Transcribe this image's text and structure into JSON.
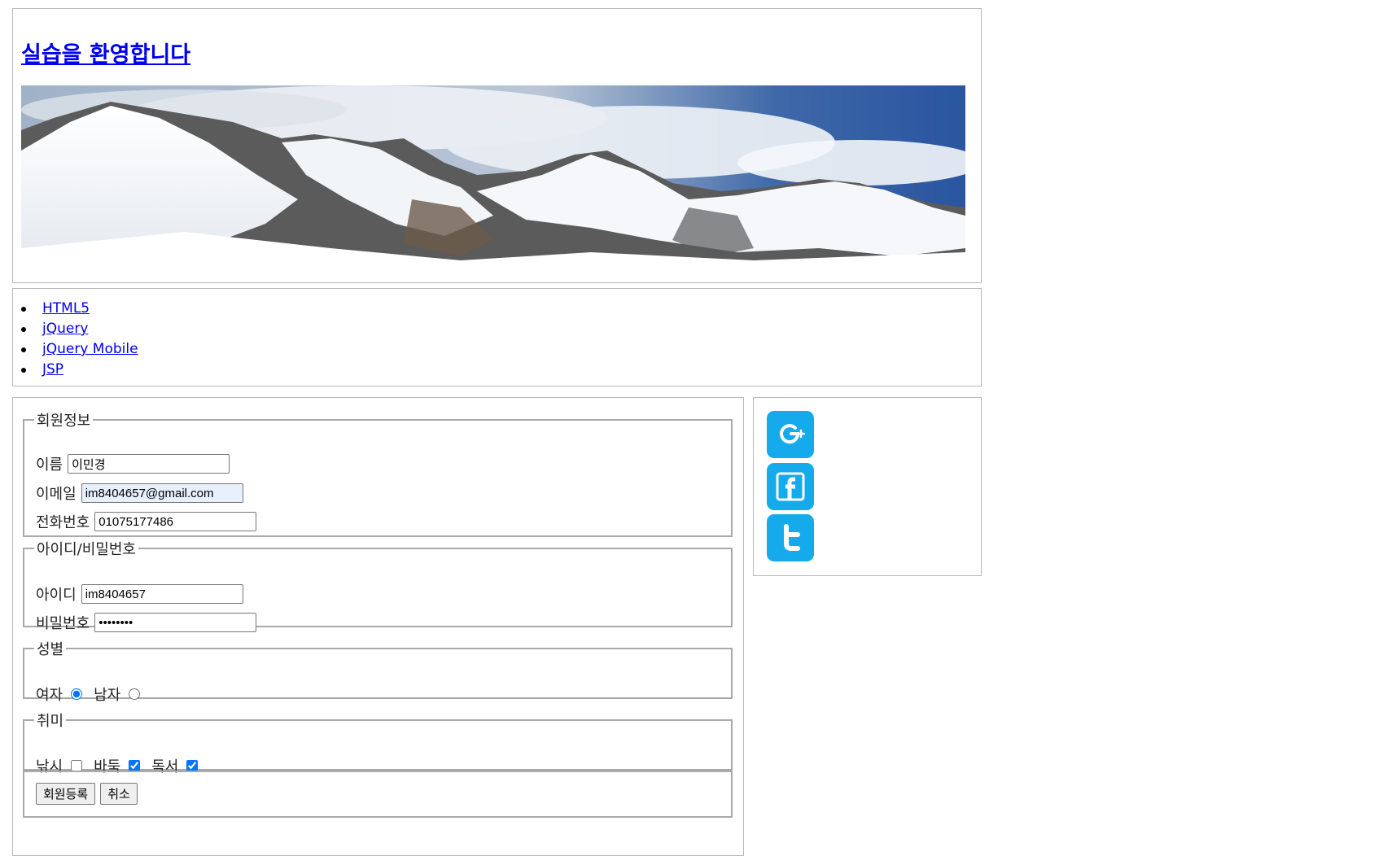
{
  "header": {
    "title": "실습을 환영합니다"
  },
  "nav": {
    "items": [
      "HTML5",
      "jQuery",
      "jQuery Mobile",
      "JSP"
    ]
  },
  "form": {
    "member_info": {
      "legend": "회원정보",
      "name_label": "이름",
      "name_value": "이민경",
      "email_label": "이메일",
      "email_value": "im8404657@gmail.com",
      "phone_label": "전화번호",
      "phone_value": "01075177486"
    },
    "account": {
      "legend": "아이디/비밀번호",
      "id_label": "아이디",
      "id_value": "im8404657",
      "pw_label": "비밀번호",
      "pw_value": "........"
    },
    "gender": {
      "legend": "성별",
      "female_label": "여자",
      "male_label": "남자",
      "selected": "female"
    },
    "hobby": {
      "legend": "취미",
      "fishing_label": "낚시",
      "baduk_label": "바둑",
      "reading_label": "독서",
      "checked": [
        "baduk",
        "reading"
      ]
    },
    "buttons": {
      "submit_label": "회원등록",
      "cancel_label": "취소"
    }
  },
  "social": {
    "icons": [
      "google-plus-icon",
      "facebook-icon",
      "twitter-icon"
    ]
  },
  "colors": {
    "link": "#0000ee",
    "social_icon_bg": "#14aaec"
  }
}
